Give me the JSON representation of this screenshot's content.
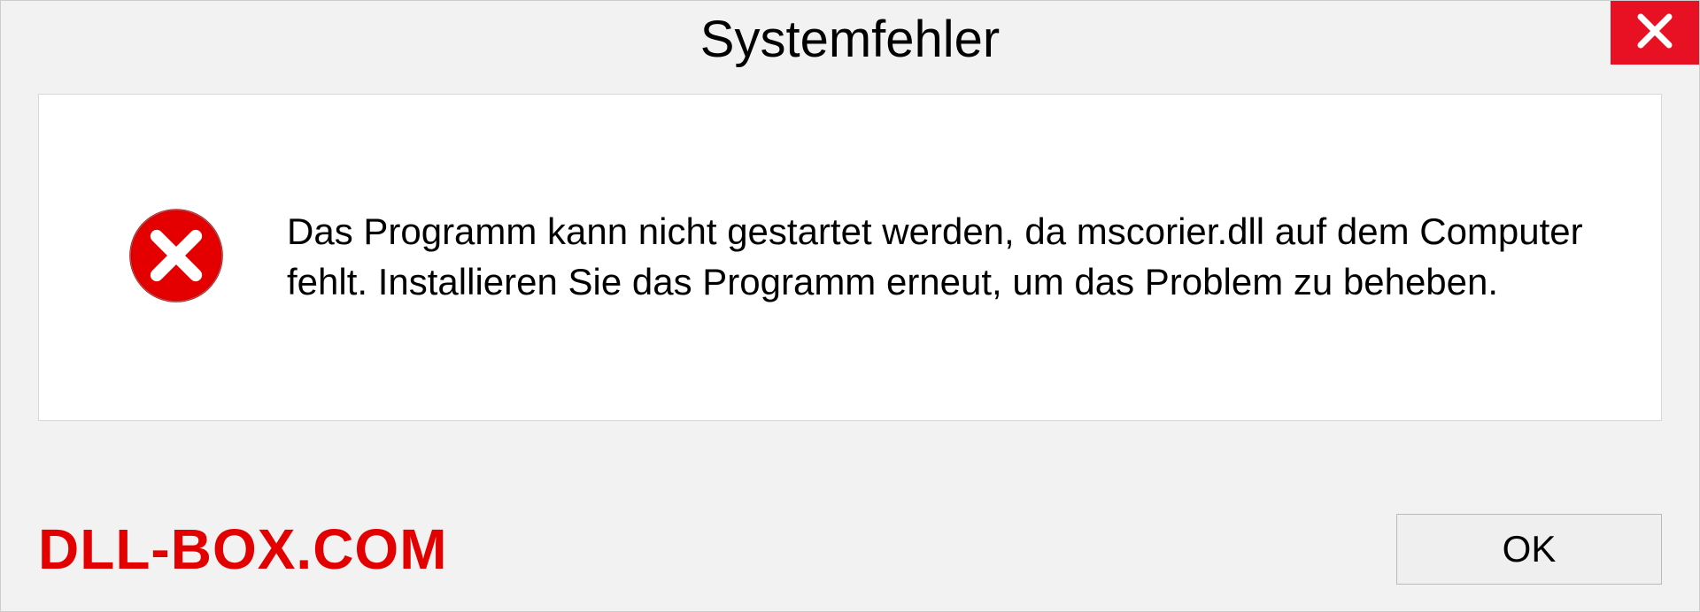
{
  "dialog": {
    "title": "Systemfehler",
    "message": "Das Programm kann nicht gestartet werden, da mscorier.dll auf dem Computer fehlt. Installieren Sie das Programm erneut, um das Problem zu beheben.",
    "ok_label": "OK"
  },
  "watermark": "DLL-BOX.COM"
}
